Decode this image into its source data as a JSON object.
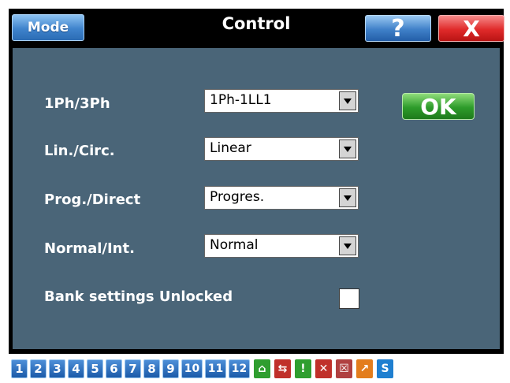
{
  "window": {
    "title": "Control",
    "mode_label": "Mode",
    "help_label": "?",
    "close_label": "X"
  },
  "form": {
    "fields": [
      {
        "label": "1Ph/3Ph",
        "value": "1Ph-1LL1"
      },
      {
        "label": "Lin./Circ.",
        "value": "Linear"
      },
      {
        "label": "Prog./Direct",
        "value": "Progres."
      },
      {
        "label": "Normal/Int.",
        "value": "Normal"
      }
    ],
    "ok_label": "OK",
    "bank_label": "Bank settings Unlocked",
    "bank_checked": false
  },
  "bottombar": {
    "numbers": [
      "1",
      "2",
      "3",
      "4",
      "5",
      "6",
      "7",
      "8",
      "9",
      "10",
      "11",
      "12"
    ],
    "icons": [
      {
        "name": "unlock-icon",
        "glyph": "⌂",
        "color": "#2f9e2f"
      },
      {
        "name": "crossed-arrows-icon",
        "glyph": "⇆",
        "color": "#c0302a"
      },
      {
        "name": "thermometer-icon",
        "glyph": "!",
        "color": "#2f9e2f"
      },
      {
        "name": "crossed-plug-icon",
        "glyph": "✕",
        "color": "#c0302a"
      },
      {
        "name": "crossed-box-icon",
        "glyph": "☒",
        "color": "#b04040"
      },
      {
        "name": "arrow-out-icon",
        "glyph": "↗",
        "color": "#e37d1c"
      },
      {
        "name": "s-icon",
        "glyph": "S",
        "color": "#1f7fd0"
      }
    ]
  }
}
